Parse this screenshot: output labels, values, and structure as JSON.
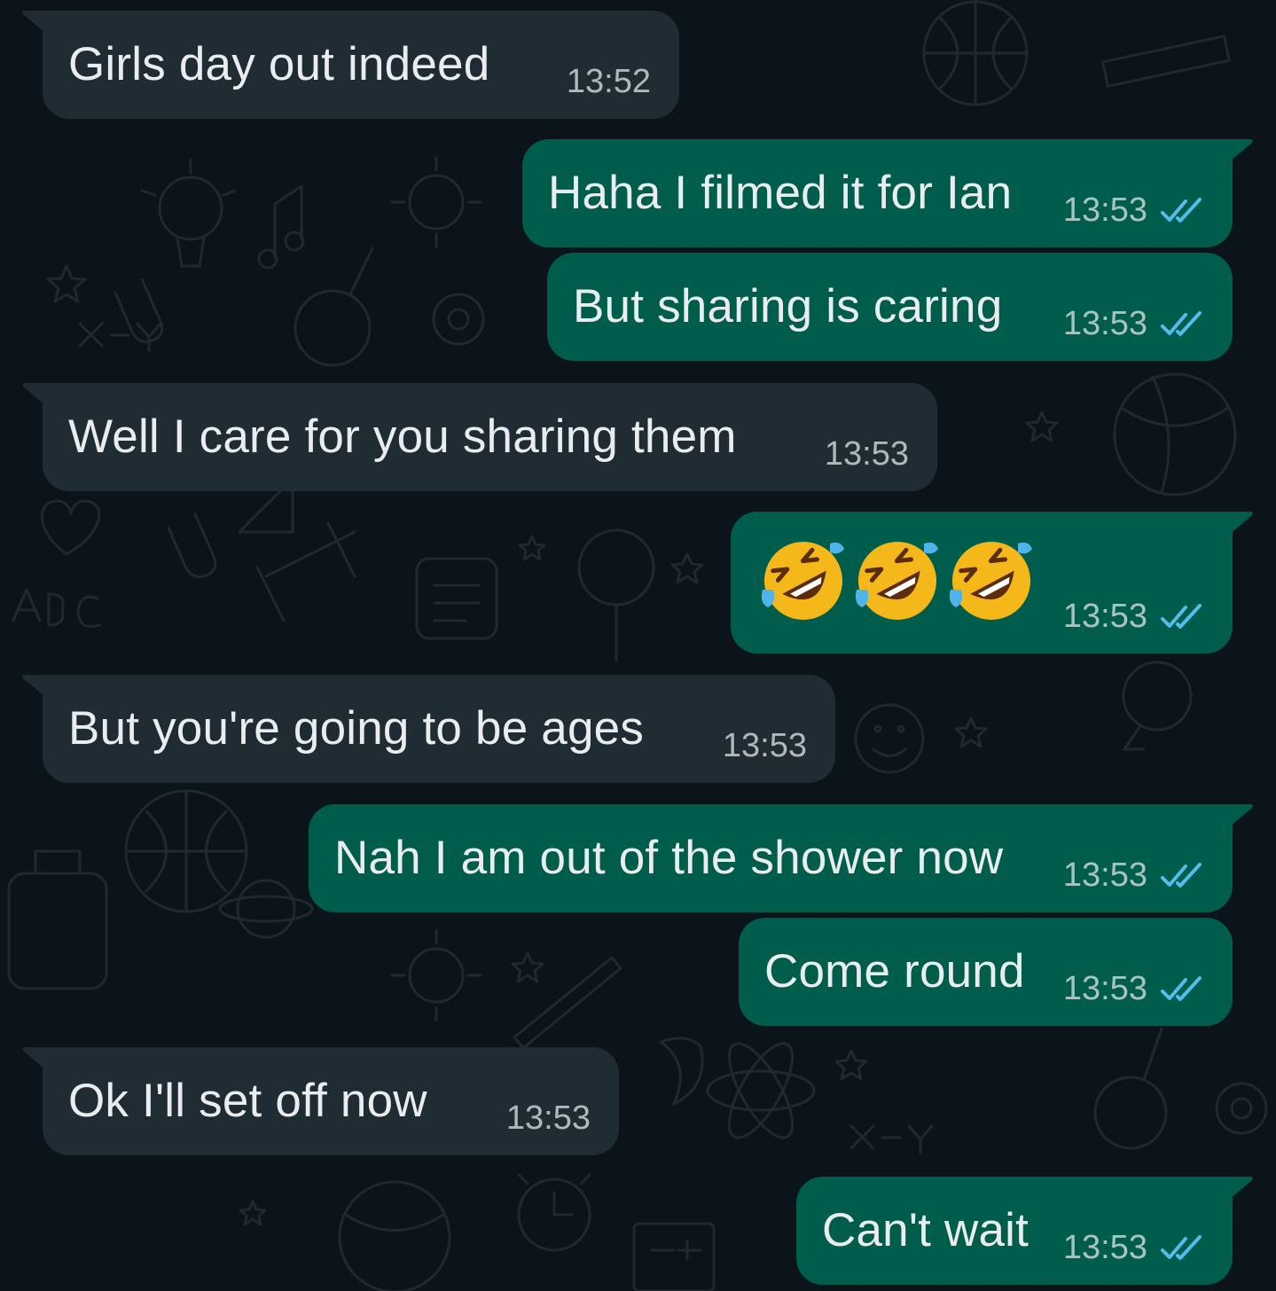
{
  "chat": {
    "messages": [
      {
        "direction": "in",
        "text": "Girls day out indeed",
        "time": "13:52"
      },
      {
        "direction": "out",
        "text": "Haha I filmed it for Ian",
        "time": "13:53",
        "status": "read"
      },
      {
        "direction": "out",
        "text": "But sharing is caring",
        "time": "13:53",
        "status": "read"
      },
      {
        "direction": "in",
        "text": "Well I care for you sharing them",
        "time": "13:53"
      },
      {
        "direction": "out",
        "text": "🤣🤣🤣",
        "emoji_name": "rolling-on-the-floor-laughing",
        "emoji_count": 3,
        "time": "13:53",
        "status": "read"
      },
      {
        "direction": "in",
        "text": "But you're going to be ages",
        "time": "13:53"
      },
      {
        "direction": "out",
        "text": "Nah I am out of the shower now",
        "time": "13:53",
        "status": "read"
      },
      {
        "direction": "out",
        "text": "Come round",
        "time": "13:53",
        "status": "read"
      },
      {
        "direction": "in",
        "text": "Ok I'll set off now",
        "time": "13:53"
      },
      {
        "direction": "out",
        "text": "Can't wait",
        "time": "13:53",
        "status": "read"
      }
    ]
  },
  "colors": {
    "background": "#0b141a",
    "incoming_bubble": "#202c33",
    "outgoing_bubble": "#005c4b",
    "message_text": "#e9edef",
    "read_ticks": "#53bdeb"
  }
}
